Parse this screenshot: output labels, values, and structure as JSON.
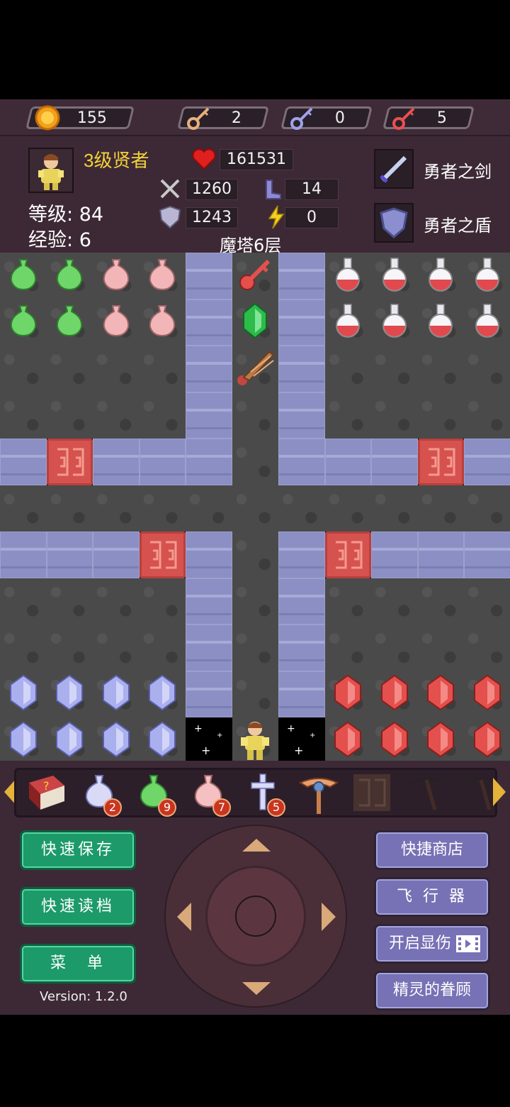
{
  "resources": {
    "gold": "155",
    "yellow_key": "2",
    "blue_key": "0",
    "red_key": "5"
  },
  "hero": {
    "title": "3级贤者",
    "level_label": "等级:",
    "level": "84",
    "exp_label": "经验:",
    "exp": "6",
    "hp": "161531",
    "attack": "1260",
    "defense": "1243",
    "agility": "14",
    "magic": "0"
  },
  "floor": "魔塔6层",
  "equipment": {
    "weapon": "勇者之剑",
    "shield": "勇者之盾"
  },
  "items": [
    {
      "name": "monster-manual-icon",
      "count": ""
    },
    {
      "name": "blue-flask-icon",
      "count": "2"
    },
    {
      "name": "green-flask-icon",
      "count": "9"
    },
    {
      "name": "pink-flask-icon",
      "count": "7"
    },
    {
      "name": "cross-icon",
      "count": "5"
    },
    {
      "name": "fly-staff-icon",
      "count": ""
    },
    {
      "name": "door-icon",
      "count": ""
    },
    {
      "name": "pickaxe-icon",
      "count": ""
    },
    {
      "name": "pickaxe-icon",
      "count": ""
    }
  ],
  "buttons": {
    "quick_save": "快速保存",
    "quick_load": "快速读档",
    "menu": "菜　单",
    "quick_shop": "快捷商店",
    "flyer": "飞 行 器",
    "show_damage": "开启显伤",
    "fairy": "精灵的眷顾"
  },
  "version": "Version: 1.2.0",
  "colors": {
    "gold_text": "#f2d23a",
    "green_button": "#1d9a6a",
    "purple_button": "#7771b5",
    "door_red": "#d6524f",
    "wall_lavender": "#8c8fc3"
  }
}
